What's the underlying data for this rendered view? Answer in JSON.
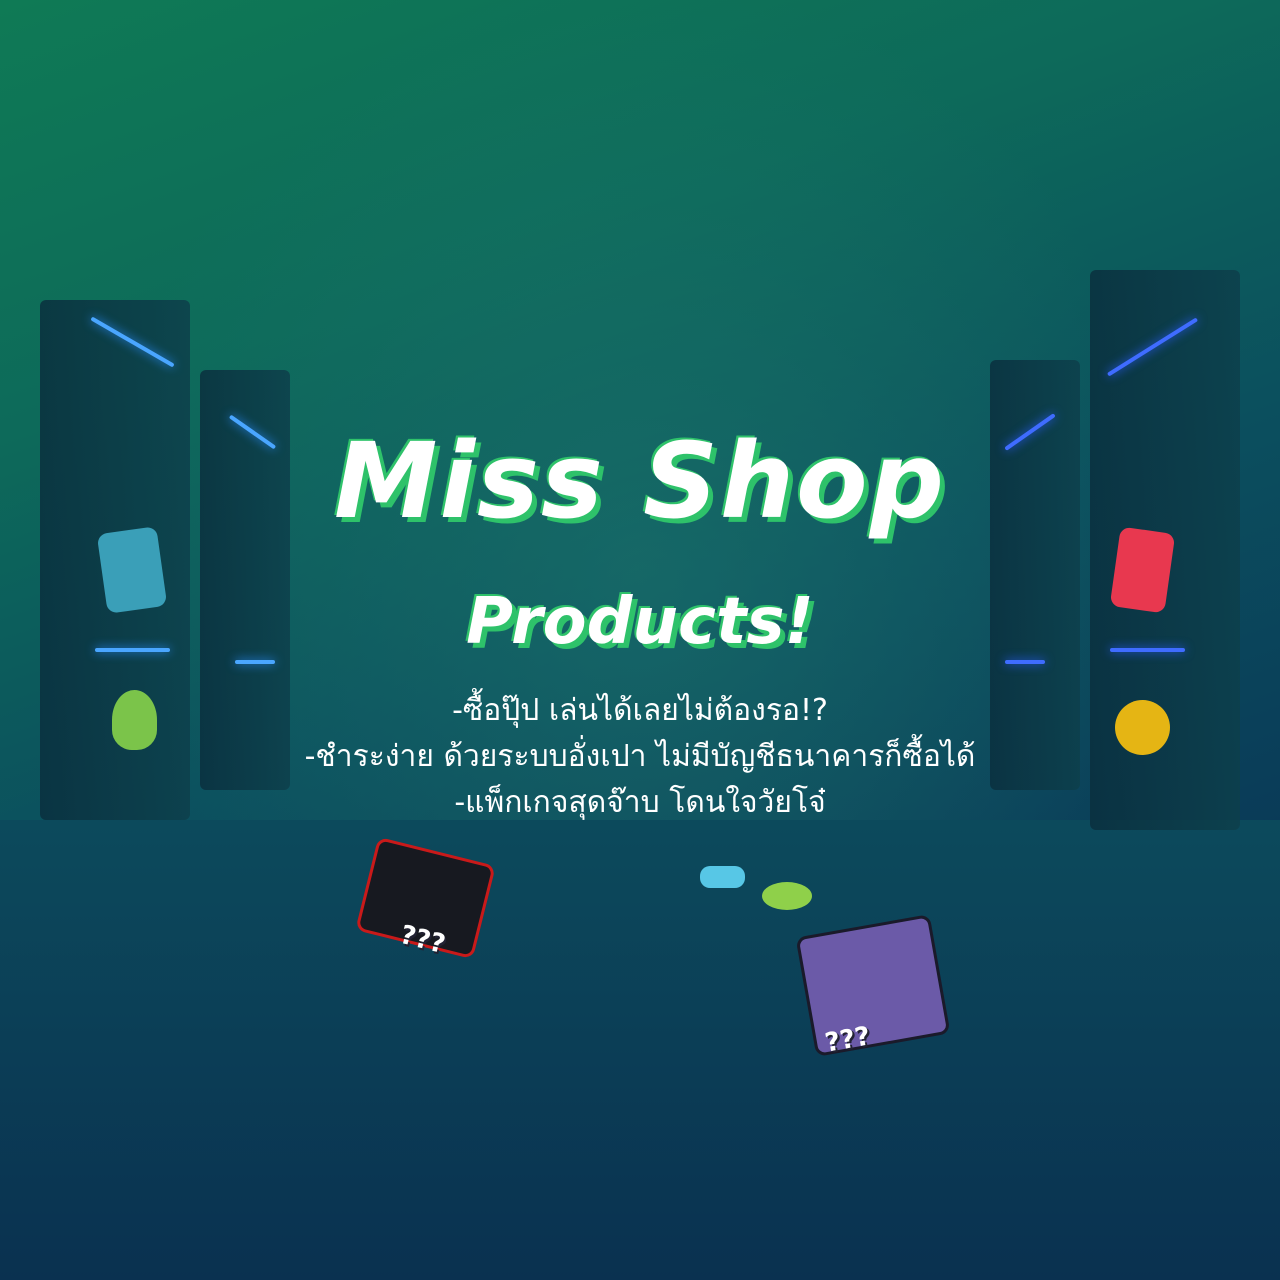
{
  "title": "Miss Shop",
  "subtitle": "Products!",
  "lines": [
    "-ซื้อปุ๊ป เล่นได้เลยไม่ต้องรอ!?",
    "-ชำระง่าย ด้วยระบบอั่งเปา ไม่มีบัญชีธนาคารก็ซื้อได้",
    "-แพ็กเกจสุดจ๊าบ โดนใจวัยโจ๋"
  ],
  "mystery_label": "???",
  "colors": {
    "accent": "#2ec26a",
    "neon_left": "#2a8cff",
    "neon_right": "#2a5cff"
  }
}
